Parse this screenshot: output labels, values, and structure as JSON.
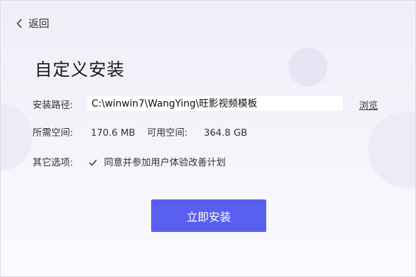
{
  "back": {
    "label": "返回"
  },
  "title": "自定义安装",
  "path": {
    "label": "安装路径:",
    "value": "C:\\winwin7\\WangYing\\旺影视频模板",
    "browse": "浏览"
  },
  "space": {
    "required_label": "所需空间:",
    "required_value": "170.6 MB",
    "available_label": "可用空间:",
    "available_value": "364.8 GB"
  },
  "options": {
    "label": "其它选项:",
    "checkbox_label": "同意并参加用户体验改善计划",
    "checked": true
  },
  "install_button": "立即安装",
  "colors": {
    "primary": "#5960f0"
  }
}
